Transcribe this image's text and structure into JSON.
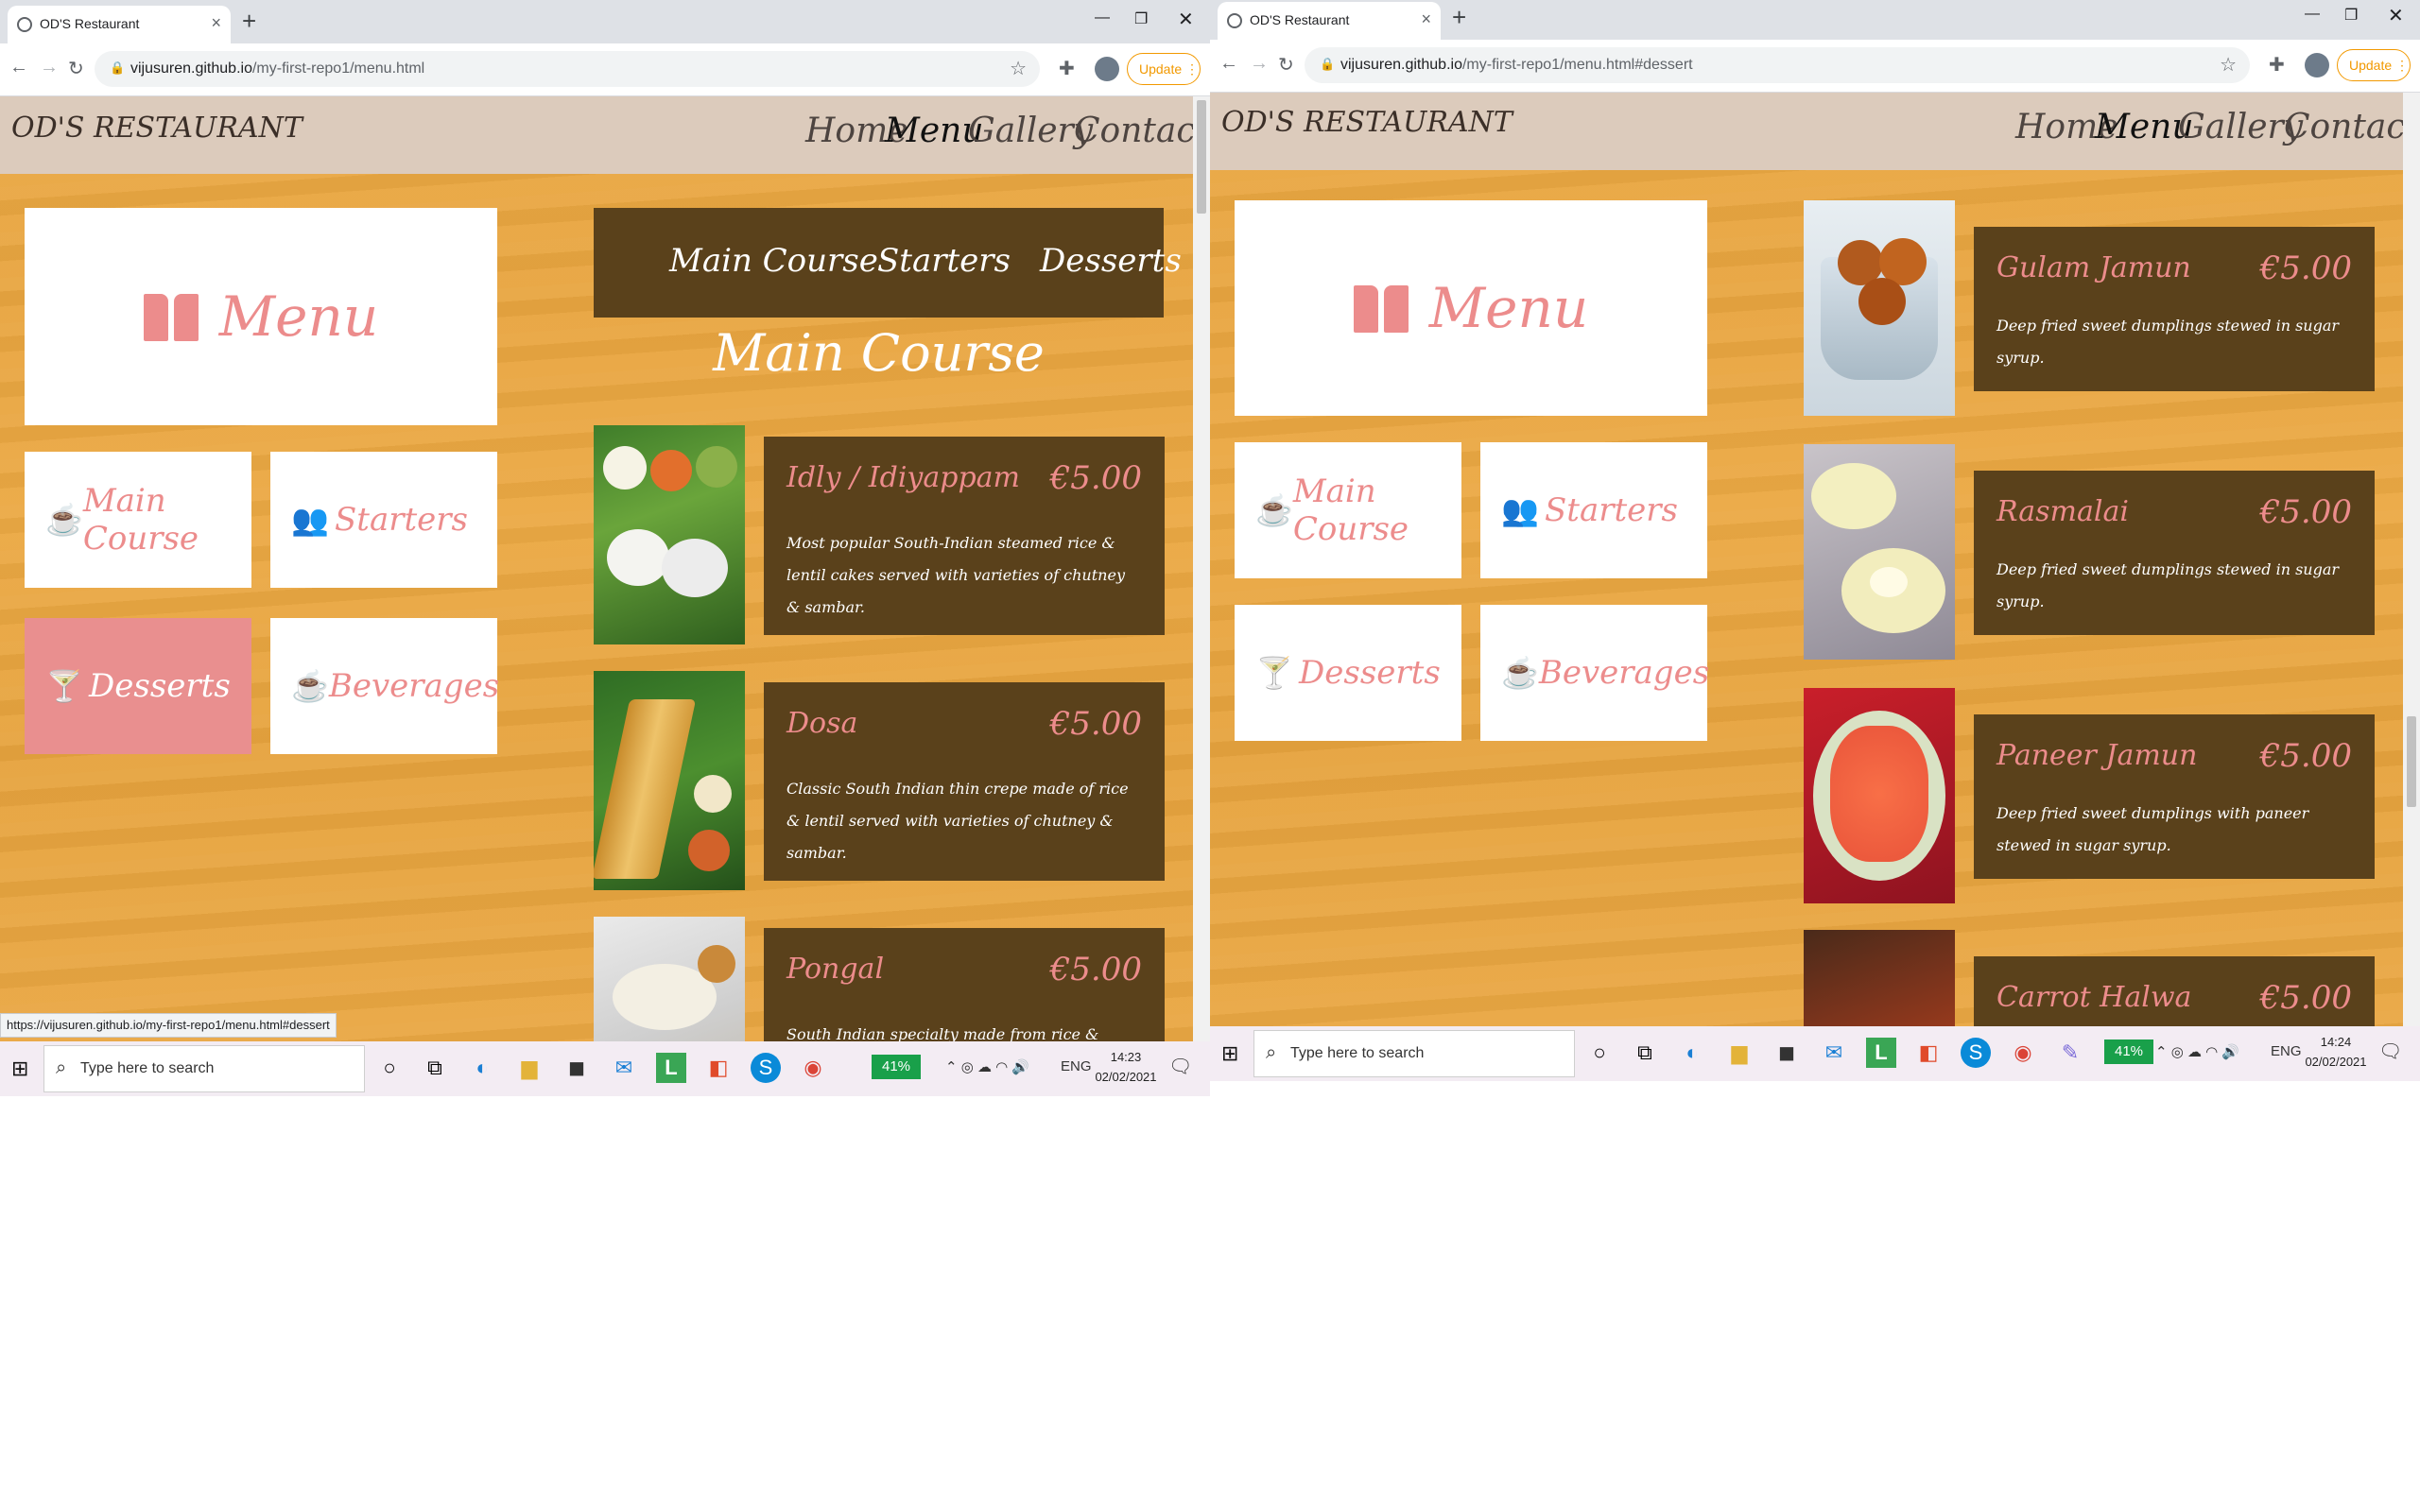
{
  "left": {
    "browser": {
      "tab_title": "OD'S Restaurant",
      "tab_close": "×",
      "new_tab": "+",
      "url_host": "vijusuren.github.io",
      "url_path": "/my-first-repo1/menu.html",
      "update_label": "Update",
      "status_url": "https://vijusuren.github.io/my-first-repo1/menu.html#dessert"
    },
    "site": {
      "logo": "OD'S RESTAURANT",
      "nav": [
        "Home",
        "Menu",
        "Gallery",
        "Contact"
      ],
      "menu_title": "Menu",
      "categories": [
        "Main Course",
        "Starters",
        "Desserts",
        "Beverages"
      ],
      "active_category": "Desserts",
      "section_tabs": [
        "Main Course",
        "Starters",
        "Desserts"
      ],
      "section_heading": "Main Course",
      "dishes": [
        {
          "name": "Idly / Idiyappam",
          "price": "€5.00",
          "desc": "Most popular South-Indian steamed rice & lentil cakes served with varieties of chutney & sambar."
        },
        {
          "name": "Dosa",
          "price": "€5.00",
          "desc": "Classic South Indian thin crepe made of rice & lentil served with varieties of chutney & sambar."
        },
        {
          "name": "Pongal",
          "price": "€5.00",
          "desc": "South Indian specialty made from rice & lentil cooked served"
        }
      ]
    },
    "taskbar": {
      "search_placeholder": "Type here to search",
      "battery": "41%",
      "lang": "ENG",
      "time": "14:23",
      "date": "02/02/2021"
    }
  },
  "right": {
    "browser": {
      "tab_title": "OD'S Restaurant",
      "tab_close": "×",
      "new_tab": "+",
      "url_host": "vijusuren.github.io",
      "url_path": "/my-first-repo1/menu.html#dessert",
      "update_label": "Update"
    },
    "site": {
      "logo": "OD'S RESTAURANT",
      "nav": [
        "Home",
        "Menu",
        "Gallery",
        "Contact"
      ],
      "menu_title": "Menu",
      "categories": [
        "Main Course",
        "Starters",
        "Desserts",
        "Beverages"
      ],
      "dishes": [
        {
          "name": "Gulam Jamun",
          "price": "€5.00",
          "desc": "Deep fried sweet dumplings stewed in sugar syrup."
        },
        {
          "name": "Rasmalai",
          "price": "€5.00",
          "desc": "Deep fried sweet dumplings stewed in sugar syrup."
        },
        {
          "name": "Paneer Jamun",
          "price": "€5.00",
          "desc": "Deep fried sweet dumplings with paneer stewed in sugar syrup."
        },
        {
          "name": "Carrot Halwa",
          "price": "€5.00",
          "desc": ""
        }
      ]
    },
    "taskbar": {
      "search_placeholder": "Type here to search",
      "battery": "41%",
      "lang": "ENG",
      "time": "14:24",
      "date": "02/02/2021"
    }
  },
  "icons": {
    "back": "back-arrow-icon",
    "forward": "forward-arrow-icon",
    "reload": "reload-icon",
    "lock": "lock-icon",
    "star": "bookmark-star-icon",
    "book": "book-icon",
    "coffee": "coffee-cup-icon",
    "users": "users-icon",
    "glass": "cocktail-glass-icon"
  },
  "colors": {
    "accent_pink": "#ec8c8c",
    "panel_brown": "#5a411b",
    "header_beige": "#dccbbc",
    "wood_orange": "#e9a843"
  }
}
